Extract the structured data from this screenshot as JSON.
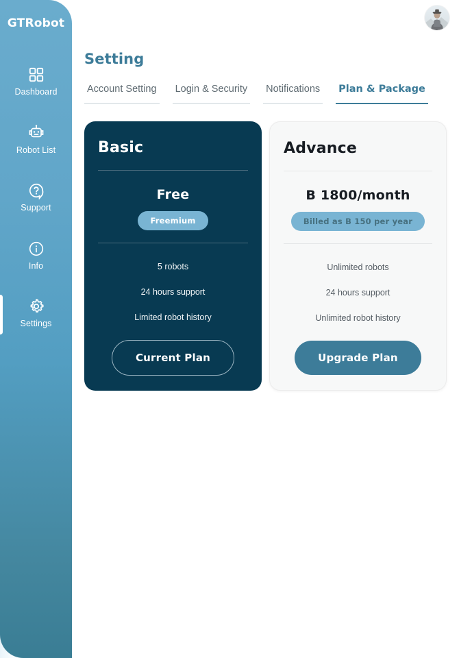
{
  "sidebar": {
    "brand": "GTRobot",
    "items": [
      {
        "label": "Dashboard",
        "icon": "grid-icon",
        "active": false
      },
      {
        "label": "Robot List",
        "icon": "robot-icon",
        "active": false
      },
      {
        "label": "Support",
        "icon": "question-circle-icon",
        "active": false
      },
      {
        "label": "Info",
        "icon": "info-circle-icon",
        "active": false
      },
      {
        "label": "Settings",
        "icon": "gear-icon",
        "active": true
      }
    ]
  },
  "header": {
    "title": "Setting",
    "avatar_icon": "user-avatar-photo"
  },
  "tabs": [
    {
      "label": "Account  Setting",
      "active": false
    },
    {
      "label": "Login & Security",
      "active": false
    },
    {
      "label": "Notifications",
      "active": false
    },
    {
      "label": "Plan & Package",
      "active": true
    }
  ],
  "plans": [
    {
      "name": "Basic",
      "price": "Free",
      "badge": "Freemium",
      "features": [
        "5 robots",
        "24 hours support",
        "Limited robot history"
      ],
      "cta": "Current Plan",
      "style": "dark"
    },
    {
      "name": "Advance",
      "price": "B 1800/month",
      "badge": "Billed as B 150 per year",
      "features": [
        "Unlimited robots",
        "24 hours support",
        "Unlimited robot history"
      ],
      "cta": "Upgrade Plan",
      "style": "light"
    }
  ],
  "colors": {
    "sidebar_top": "#6aaccd",
    "sidebar_bottom": "#3a7d94",
    "accent": "#3d7c99",
    "dark_card": "#083a52",
    "light_card": "#f7f8f8",
    "badge": "#79b4d3"
  }
}
